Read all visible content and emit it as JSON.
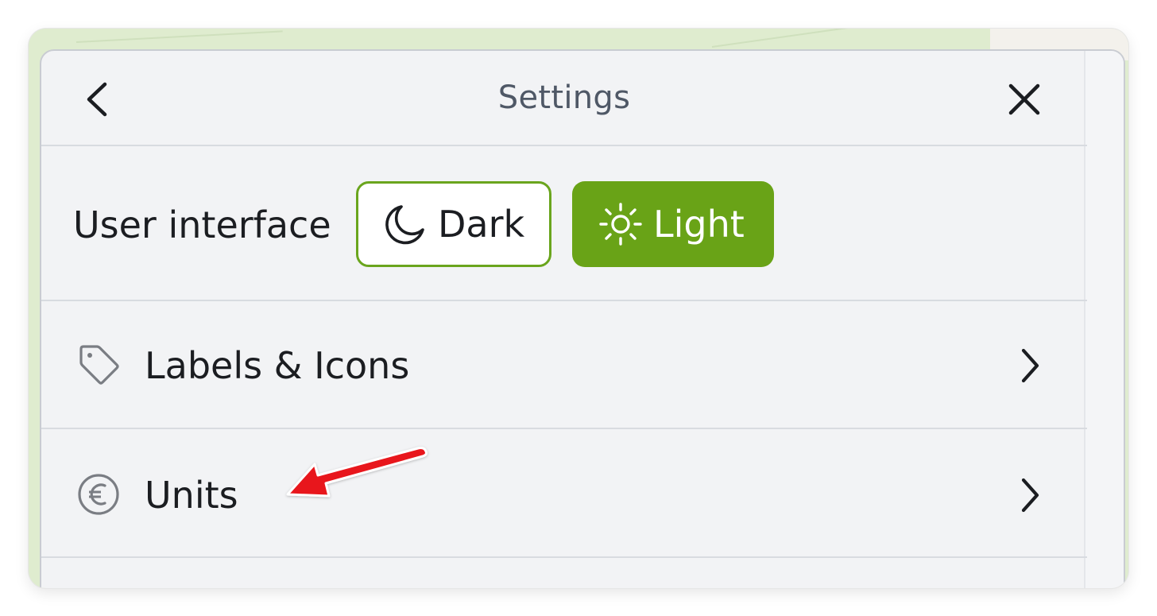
{
  "header": {
    "title": "Settings"
  },
  "appearance": {
    "label": "User interface",
    "options": [
      {
        "label": "Dark",
        "icon": "moon-icon",
        "selected": false
      },
      {
        "label": "Light",
        "icon": "sun-icon",
        "selected": true
      }
    ]
  },
  "menu": {
    "items": [
      {
        "label": "Labels & Icons",
        "icon": "tag-icon"
      },
      {
        "label": "Units",
        "icon": "euro-icon"
      }
    ]
  },
  "colors": {
    "accent": "#69a317",
    "panel_bg": "#f2f3f5",
    "annotation_arrow": "#e8191c"
  }
}
